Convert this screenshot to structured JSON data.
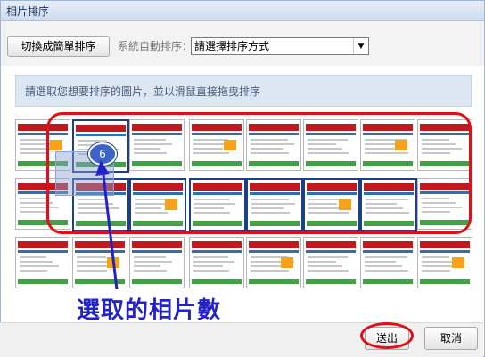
{
  "dialog": {
    "title": "相片排序"
  },
  "toolbar": {
    "switch_label": "切換成簡單排序",
    "auto_sort_label": "系統自動排序：",
    "sort_select_value": "請選擇排序方式"
  },
  "hint": {
    "text": "請選取您想要排序的圖片，並以滑鼠直接拖曳排序"
  },
  "drag": {
    "selected_count": "6"
  },
  "annotation": {
    "text": "選取的相片數"
  },
  "footer": {
    "submit_label": "送出",
    "cancel_label": "取消"
  },
  "colors": {
    "annotation_red": "#e0101b",
    "annotation_blue": "#2222c8",
    "selection_border": "#1d3f8a"
  },
  "icons": {
    "dropdown": "chevron-down-icon",
    "arrow": "annotation-arrow-icon"
  }
}
